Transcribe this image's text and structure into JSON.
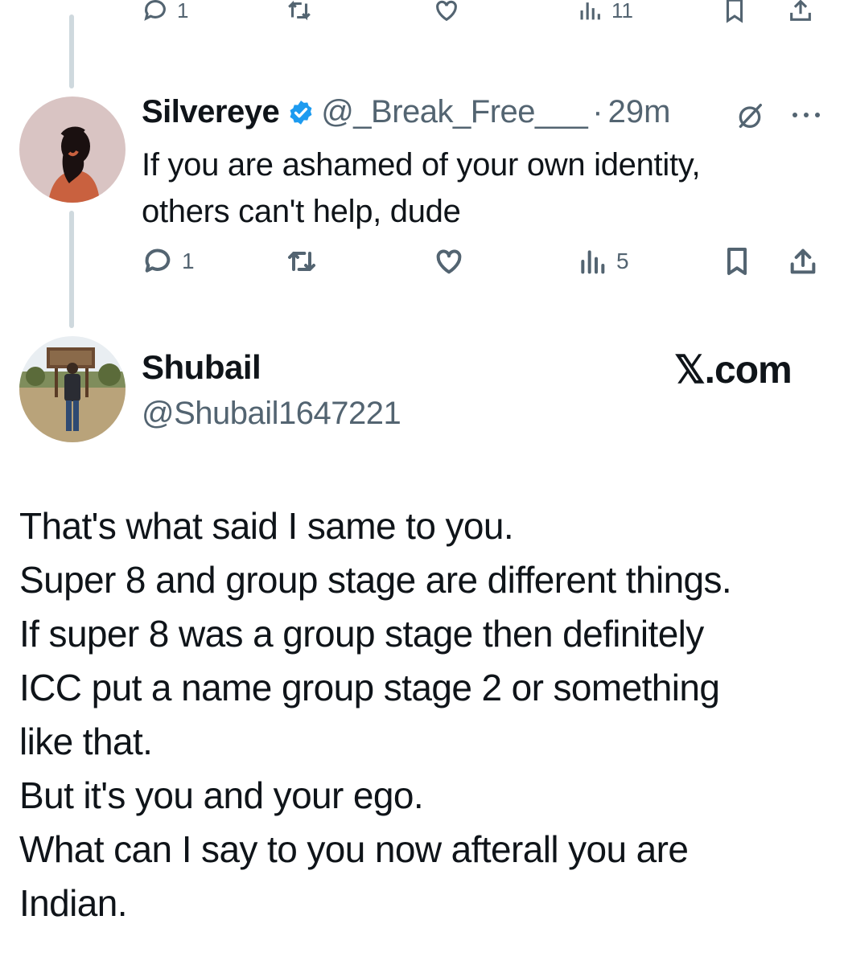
{
  "top_actions": {
    "reply_count": "1",
    "views_count": "11"
  },
  "tweet": {
    "author_name": "Silvereye",
    "author_handle": "@_Break_Free___",
    "separator": "·",
    "time": "29m",
    "text_lines": [
      "If you are ashamed of your own identity,",
      "others can't help, dude"
    ],
    "reply_count": "1",
    "views_count": "5"
  },
  "reply_card": {
    "author_name": "Shubail",
    "author_handle": "@Shubail1647221",
    "brand": "𝕏.com",
    "text_lines": [
      "That's what said I same to you.",
      "Super 8 and group stage are different things.",
      "If super 8 was a group stage then definitely",
      "ICC put a name group stage 2 or something",
      "like that.",
      "But it's you and your ego.",
      "What can I say to you now afterall you are",
      "Indian."
    ]
  },
  "icons": [
    "reply-icon",
    "retweet-icon",
    "like-icon",
    "views-icon",
    "bookmark-icon",
    "share-icon",
    "verified-badge-icon",
    "grok-icon",
    "more-icon"
  ],
  "colors": {
    "text": "#0f1419",
    "secondary": "#536471",
    "verified": "#1d9bf0",
    "thread_line": "#cfd9de"
  }
}
